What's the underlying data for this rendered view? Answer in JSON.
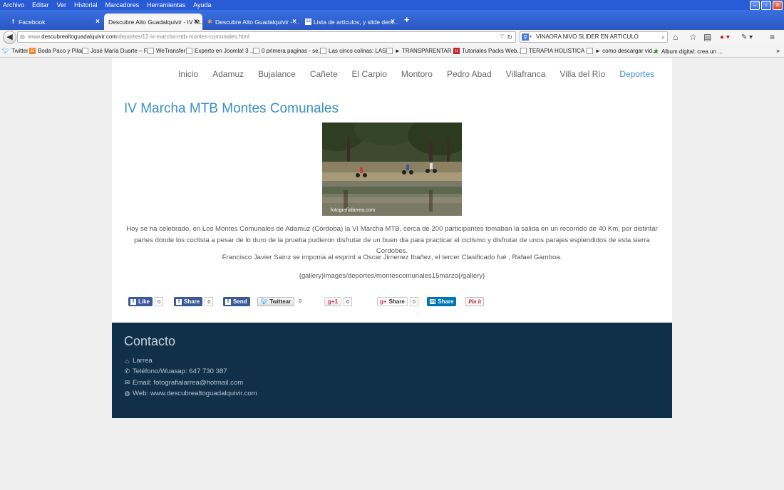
{
  "browser": {
    "menu": [
      "Archivo",
      "Editar",
      "Ver",
      "Historial",
      "Marcadores",
      "Herramientas",
      "Ayuda"
    ],
    "tabs": [
      {
        "label": "Facebook",
        "icon": "facebook-icon"
      },
      {
        "label": "Descubre Alto Guadalquivir - IV M...",
        "icon": "page-icon"
      },
      {
        "label": "Descubre Alto Guadalquivir - ...",
        "icon": "joomla-icon"
      },
      {
        "label": "Lista de artículos, y slide dent...",
        "icon": "site-icon"
      }
    ],
    "url_host": "www.descubrealtoguadalquivir.com",
    "url_path": "/deportes/12-iv-marcha-mtb-montes-comunales.html",
    "url_prefix": "www.",
    "url_host_main": "descubrealtoguadalquivir.com",
    "search_value": "VINAORA NIVO SLIDER EN ARTICULO",
    "bookmarks": [
      "Twitter",
      "Boda Paco y Pilar",
      "José María Duarte – F...",
      "WeTransfer",
      "Experto en Joomla! 3 ...",
      "0 primera paginas - se...",
      "Las cinco colinas: LAS ...",
      "► TRANSPARENTAR I...",
      "Tutoriales Packs Web...",
      "TERAPIA HOLISTICA ...",
      "► como descargar vid...",
      "Album digital: crea un ..."
    ]
  },
  "page": {
    "nav": [
      "Inicio",
      "Adamuz",
      "Bujalance",
      "Cañete",
      "El Carpio",
      "Montoro",
      "Pedro Abad",
      "Villafranca",
      "Villa del Río",
      "Deportes"
    ],
    "title": "IV Marcha MTB Montes Comunales",
    "photo_credit": "fotografialarrea.com",
    "paragraph1": "Hoy se ha celebrado, en Los Montes Comunales de Adamuz (Córdoba) la VI Marcha MTB, cerca de 200 participantes tomaban la salida en un recorrido de 40 Km, por distintar partes donde los coclista a pesar de lo duro de la prueba pudieron disfrutar de un buen dia para practicar el ciclismo y disfrutar de unos parajes esplendidos de esta sierra Cordobes.",
    "paragraph2": "Francisco Javier Sainz se imponia al esprint a Oscar Jimenez Ibañez, el tercer Clasificado fué , Rafael Gamboa.",
    "paragraph3": "{gallery}images/deportes/montescomunales15marzo{/gallery}",
    "share": {
      "like": "Like",
      "like_count": "0",
      "share": "Share",
      "share_count": "0",
      "send": "Send",
      "tweet": "Twittear",
      "tweet_count": "0",
      "gplus": "+1",
      "gplus_count": "0",
      "gshare": "Share",
      "gshare_count": "0",
      "linkedin": "Share",
      "pinit": "Pin it"
    }
  },
  "footer": {
    "title": "Contacto",
    "name": "Larrea",
    "phone": "Teléfono/Wuasap: 647 730 387",
    "email": "Email: fotografialarrea@hotmail.com",
    "web": "Web: www.descubrealtoguadalquivir.com"
  }
}
